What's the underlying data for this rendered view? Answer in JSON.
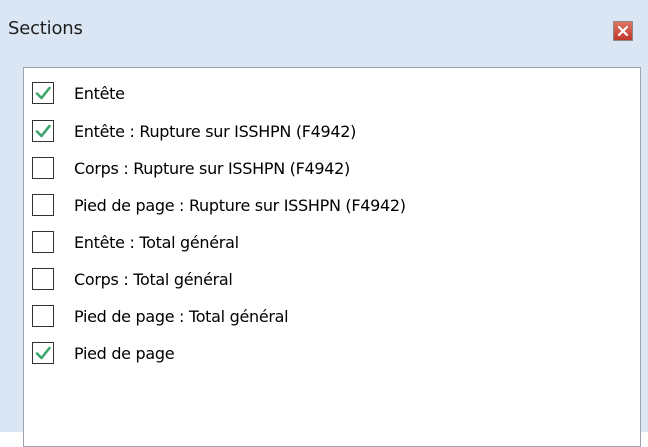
{
  "window": {
    "title": "Sections",
    "close_glyph": "×"
  },
  "colors": {
    "titlebar_bg": "#dbe6f4",
    "check_color": "#3aa56b",
    "close_red": "#c0392b"
  },
  "sections": {
    "items": [
      {
        "label": "Entête",
        "checked": true
      },
      {
        "label": "Entête : Rupture sur ISSHPN (F4942)",
        "checked": true
      },
      {
        "label": "Corps : Rupture sur ISSHPN (F4942)",
        "checked": false
      },
      {
        "label": "Pied de page : Rupture sur ISSHPN (F4942)",
        "checked": false
      },
      {
        "label": "Entête : Total général",
        "checked": false
      },
      {
        "label": "Corps : Total général",
        "checked": false
      },
      {
        "label": "Pied de page : Total général",
        "checked": false
      },
      {
        "label": "Pied de page",
        "checked": true
      }
    ]
  }
}
